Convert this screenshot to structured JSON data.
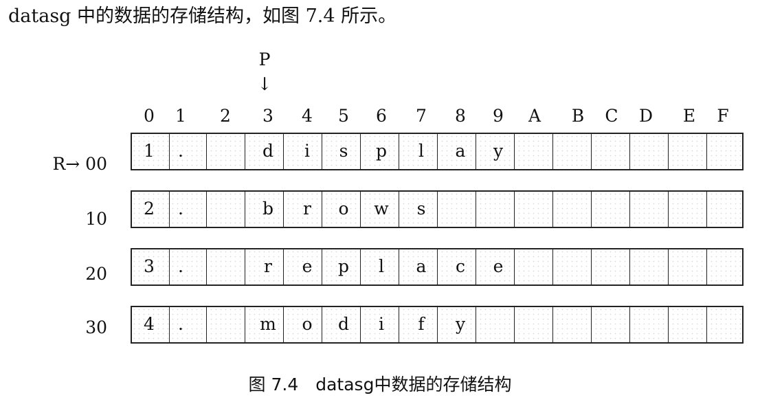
{
  "intro_text": "datasg 中的数据的存储结构，如图 7.4 所示。",
  "pointers": {
    "p_label": "P",
    "p_arrow": "↓"
  },
  "column_headers": [
    "0",
    "1",
    "2",
    "3",
    "4",
    "5",
    "6",
    "7",
    "8",
    "9",
    "A",
    "B",
    "C",
    "D",
    "E",
    "F"
  ],
  "rows": [
    {
      "label": "R→ 00",
      "cells": [
        "1",
        ".",
        "",
        "d",
        "i",
        "s",
        "p",
        "l",
        "a",
        "y",
        "",
        "",
        "",
        "",
        "",
        ""
      ]
    },
    {
      "label": "10",
      "cells": [
        "2",
        ".",
        "",
        "b",
        "r",
        "o",
        "w",
        "s",
        "",
        "",
        "",
        "",
        "",
        "",
        "",
        ""
      ]
    },
    {
      "label": "20",
      "cells": [
        "3",
        ".",
        "",
        "r",
        "e",
        "p",
        "l",
        "a",
        "c",
        "e",
        "",
        "",
        "",
        "",
        "",
        ""
      ]
    },
    {
      "label": "30",
      "cells": [
        "4",
        ".",
        "",
        "m",
        "o",
        "d",
        "i",
        "f",
        "y",
        "",
        "",
        "",
        "",
        "",
        "",
        ""
      ]
    }
  ],
  "caption": "图 7.4　datasg中数据的存储结构"
}
